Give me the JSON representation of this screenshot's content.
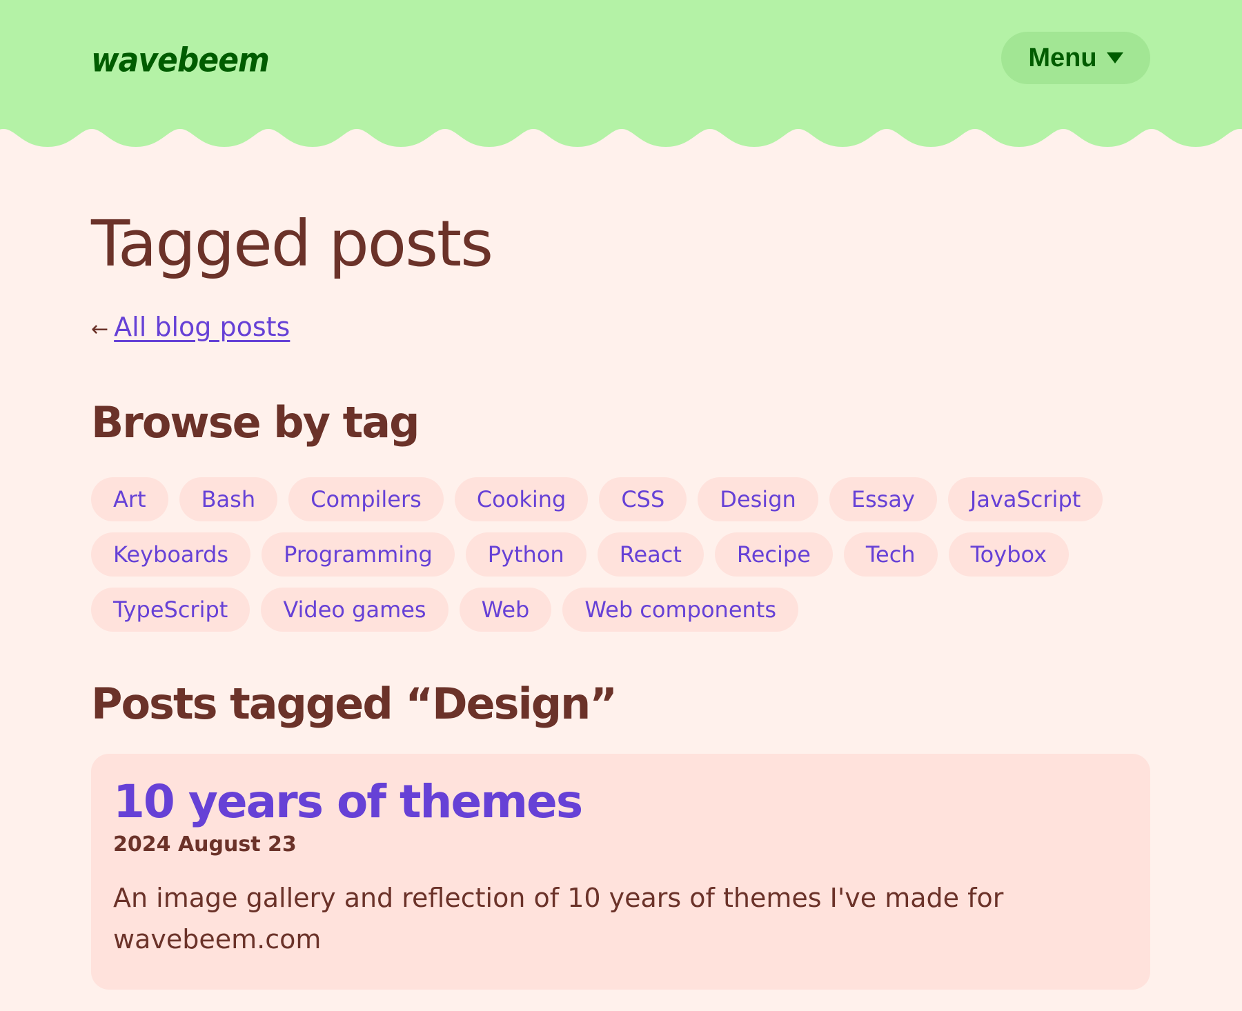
{
  "header": {
    "logo": "wavebeem",
    "menu_label": "Menu",
    "colors": {
      "header_bg": "#b4f2a6",
      "logo": "#005c00"
    }
  },
  "page": {
    "title": "Tagged posts",
    "back_arrow": "←",
    "back_link": "All blog posts"
  },
  "browse": {
    "heading": "Browse by tag",
    "tags": [
      "Art",
      "Bash",
      "Compilers",
      "Cooking",
      "CSS",
      "Design",
      "Essay",
      "JavaScript",
      "Keyboards",
      "Programming",
      "Python",
      "React",
      "Recipe",
      "Tech",
      "Toybox",
      "TypeScript",
      "Video games",
      "Web",
      "Web components"
    ]
  },
  "posts": {
    "heading": "Posts tagged “Design”",
    "items": [
      {
        "title": "10 years of themes",
        "date": "2024 August 23",
        "description": "An image gallery and reflection of 10 years of themes I've made for wavebeem.com"
      }
    ]
  },
  "colors": {
    "accent": "#6641d6",
    "text": "#6b3229",
    "background": "#fff1ec",
    "chip": "#ffe2dc"
  }
}
